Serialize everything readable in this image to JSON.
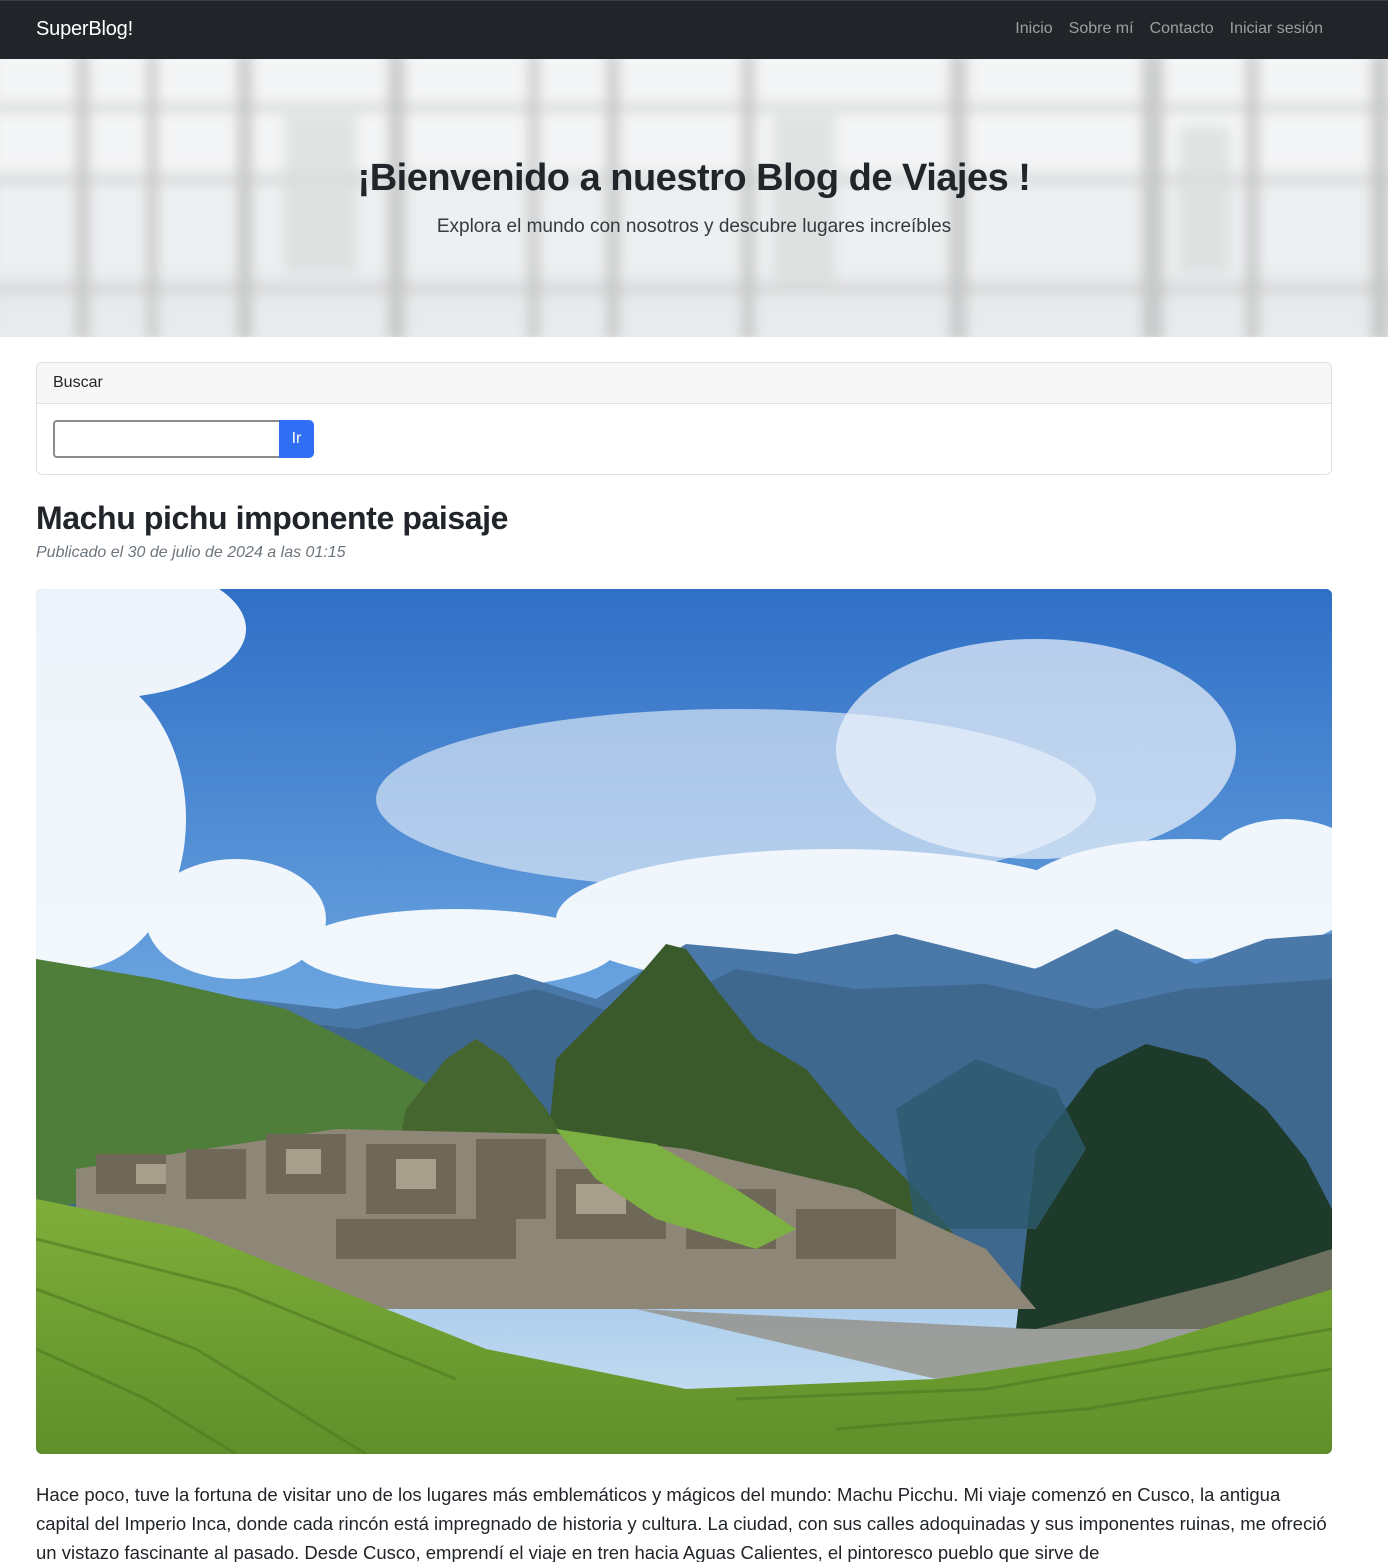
{
  "navbar": {
    "brand": "SuperBlog!",
    "links": [
      "Inicio",
      "Sobre mí",
      "Contacto",
      "Iniciar sesión"
    ],
    "background": "#212529"
  },
  "hero": {
    "title": "¡Bienvenido a nuestro Blog de Viajes !",
    "subtitle": "Explora el mundo con nosotros y descubre lugares increíbles"
  },
  "search": {
    "header": "Buscar",
    "input_value": "",
    "button_label": "Ir",
    "button_color": "#2f6ef5"
  },
  "post": {
    "title": "Machu pichu imponente paisaje",
    "meta": "Publicado el 30 de julio de 2024 a las 01:15",
    "image_icon": "machu-picchu-landscape-photo",
    "body": "Hace poco, tuve la fortuna de visitar uno de los lugares más emblemáticos y mágicos del mundo: Machu Picchu. Mi viaje comenzó en Cusco, la antigua capital del Imperio Inca, donde cada rincón está impregnado de historia y cultura. La ciudad, con sus calles adoquinadas y sus imponentes ruinas, me ofreció un vistazo fascinante al pasado. Desde Cusco, emprendí el viaje en tren hacia Aguas Calientes, el pintoresco pueblo que sirve de"
  }
}
